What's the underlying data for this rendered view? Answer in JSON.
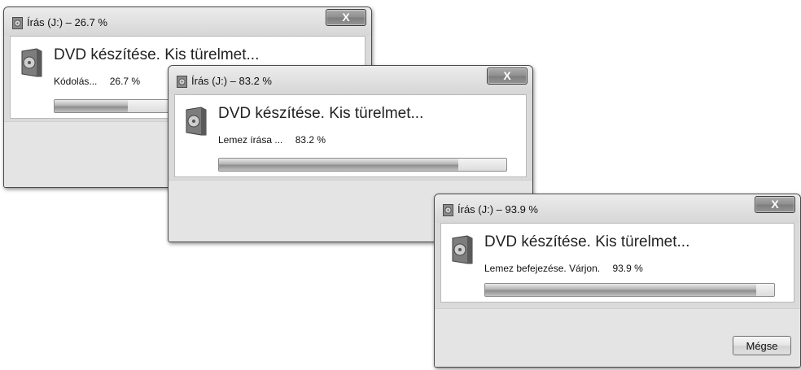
{
  "windows": [
    {
      "title": "Írás (J:) – 26.7 %",
      "heading": "DVD készítése. Kis türelmet...",
      "status_text": "Kódolás...",
      "percent_text": "26.7 %",
      "progress": 0.267,
      "close_label": "X"
    },
    {
      "title": "Írás (J:) – 83.2 %",
      "heading": "DVD készítése. Kis türelmet...",
      "status_text": "Lemez írása ...",
      "percent_text": "83.2 %",
      "progress": 0.832,
      "close_label": "X"
    },
    {
      "title": "Írás (J:) – 93.9 %",
      "heading": "DVD készítése. Kis türelmet...",
      "status_text": "Lemez befejezése. Várjon.",
      "percent_text": "93.9 %",
      "progress": 0.939,
      "close_label": "X",
      "cancel_label": "Mégse"
    }
  ],
  "icons": {
    "app": "dvd-burner-icon",
    "content": "disc-case-icon",
    "close": "close-icon"
  },
  "colors": {
    "progress_fill": "#8e8e8e",
    "frame": "#dadada"
  }
}
